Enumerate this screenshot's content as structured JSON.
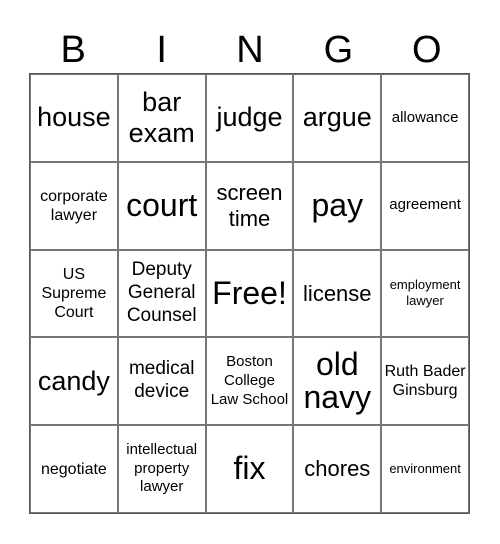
{
  "header": {
    "letters": [
      "B",
      "I",
      "N",
      "G",
      "O"
    ]
  },
  "cells": [
    {
      "text": "house",
      "size": "l"
    },
    {
      "text": "bar exam",
      "size": "l"
    },
    {
      "text": "judge",
      "size": "l"
    },
    {
      "text": "argue",
      "size": "l"
    },
    {
      "text": "allowance",
      "size": "xs"
    },
    {
      "text": "corporate lawyer",
      "size": "s"
    },
    {
      "text": "court",
      "size": "xl"
    },
    {
      "text": "screen time",
      "size": "m"
    },
    {
      "text": "pay",
      "size": "xl"
    },
    {
      "text": "agreement",
      "size": "xs"
    },
    {
      "text": "US Supreme Court",
      "size": "s"
    },
    {
      "text": "Deputy General Counsel",
      "size": "n"
    },
    {
      "text": "Free!",
      "size": "xl"
    },
    {
      "text": "license",
      "size": "m"
    },
    {
      "text": "employment lawyer",
      "size": "xxs"
    },
    {
      "text": "candy",
      "size": "l"
    },
    {
      "text": "medical device",
      "size": "n"
    },
    {
      "text": "Boston College Law School",
      "size": "xs"
    },
    {
      "text": "old navy",
      "size": "xl"
    },
    {
      "text": "Ruth Bader Ginsburg",
      "size": "s"
    },
    {
      "text": "negotiate",
      "size": "s"
    },
    {
      "text": "intellectual property lawyer",
      "size": "xs"
    },
    {
      "text": "fix",
      "size": "xl"
    },
    {
      "text": "chores",
      "size": "m"
    },
    {
      "text": "environment",
      "size": "xxs"
    }
  ]
}
